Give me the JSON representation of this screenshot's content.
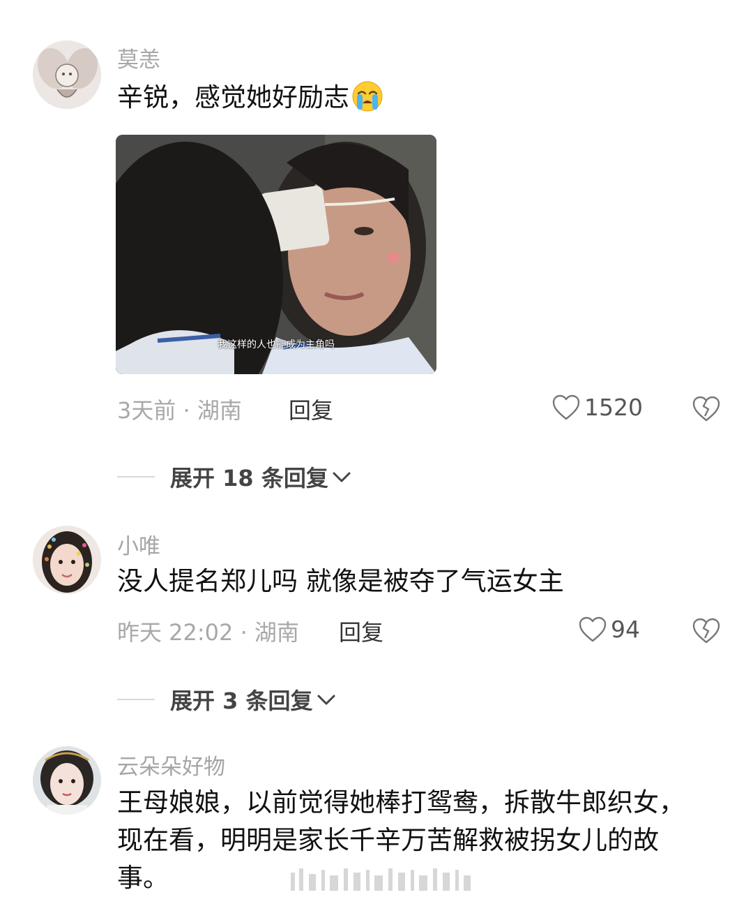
{
  "comments": [
    {
      "username": "莫恙",
      "text": "辛锐，感觉她好励志",
      "emoji": "loudly-crying-face",
      "image_subtitle": "我这样的人也能成为主角吗",
      "time_location": "3天前 · 湖南",
      "reply_label": "回复",
      "likes": "1520",
      "expand_label": "展开 18 条回复"
    },
    {
      "username": "小唯",
      "text": "没人提名郑儿吗 就像是被夺了气运女主",
      "time_location": "昨天 22:02 · 湖南",
      "reply_label": "回复",
      "likes": "94",
      "expand_label": "展开 3 条回复"
    },
    {
      "username": "云朵朵好物",
      "text": "王母娘娘，以前觉得她棒打鸳鸯，拆散牛郎织女，现在看，明明是家长千辛万苦解救被拐女儿的故事。"
    }
  ],
  "icons": {
    "like": "heart-outline-icon",
    "dislike": "broken-heart-icon",
    "expand": "chevron-down-icon"
  },
  "colors": {
    "username": "#a6a6a6",
    "meta": "#a8a8a8",
    "text": "#111111"
  }
}
